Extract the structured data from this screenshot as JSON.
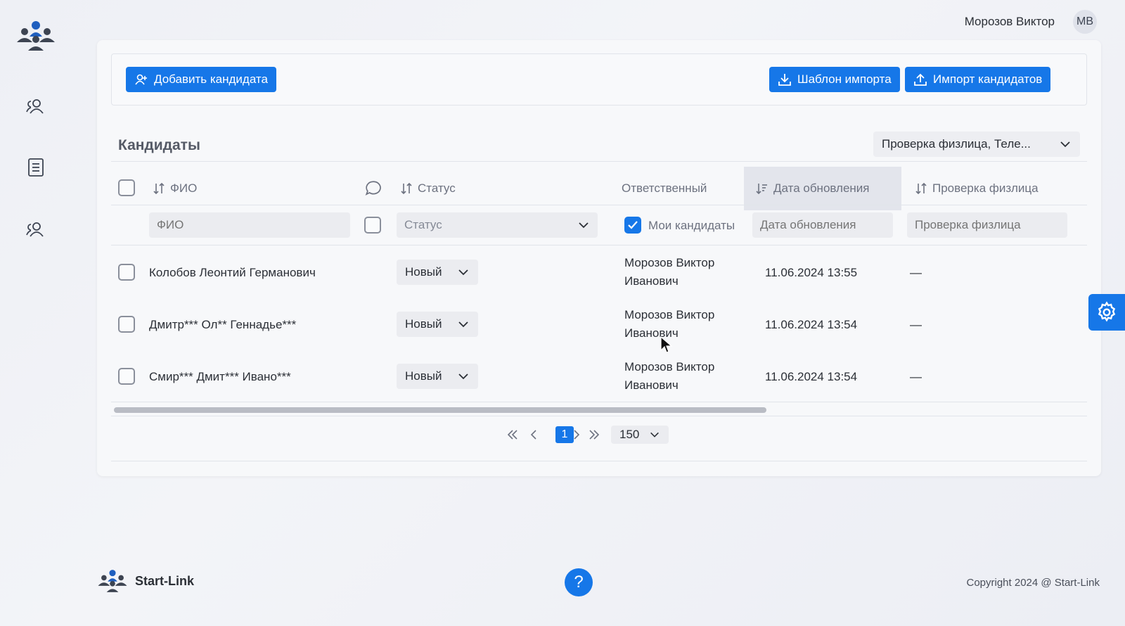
{
  "header": {
    "user_name": "Морозов Виктор",
    "avatar_initials": "МВ"
  },
  "sidebar": {
    "items": [
      {
        "icon": "users-icon"
      },
      {
        "icon": "document-icon"
      },
      {
        "icon": "users-icon"
      }
    ]
  },
  "toolbar": {
    "add_label": "Добавить кандидата",
    "template_label": "Шаблон импорта",
    "import_label": "Импорт кандидатов"
  },
  "section": {
    "title": "Кандидаты",
    "filter_value": "Проверка физлица, Теле..."
  },
  "table": {
    "columns": {
      "name": "ФИО",
      "status": "Статус",
      "responsible": "Ответственный",
      "updated": "Дата обновления",
      "check": "Проверка физлица"
    },
    "filters": {
      "name_placeholder": "ФИО",
      "status_placeholder": "Статус",
      "my_candidates": "Мои кандидаты",
      "updated_placeholder": "Дата обновления",
      "check_placeholder": "Проверка физлица"
    },
    "rows": [
      {
        "name": "Колобов Леонтий Германович",
        "status": "Новый",
        "resp1": "Морозов Виктор",
        "resp2": "Иванович",
        "updated": "11.06.2024 13:55",
        "check": "—"
      },
      {
        "name": "Дмитр*** Ол** Геннадье***",
        "status": "Новый",
        "resp1": "Морозов Виктор",
        "resp2": "Иванович",
        "updated": "11.06.2024 13:54",
        "check": "—"
      },
      {
        "name": "Смир*** Дмит*** Ивано***",
        "status": "Новый",
        "resp1": "Морозов Виктор",
        "resp2": "Иванович",
        "updated": "11.06.2024 13:54",
        "check": "—"
      }
    ]
  },
  "pagination": {
    "current_page": "1",
    "page_size": "150"
  },
  "footer": {
    "brand": "Start-Link",
    "copyright": "Copyright 2024 @ Start-Link"
  },
  "colors": {
    "accent": "#1677e8",
    "background": "#f0f1f5"
  }
}
